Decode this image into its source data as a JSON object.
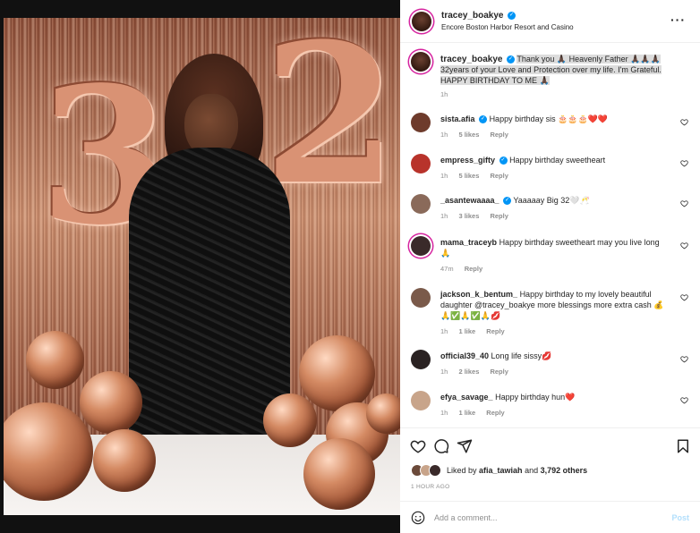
{
  "post": {
    "username": "tracey_boakye",
    "location": "Encore Boston Harbor Resort and Casino",
    "balloon_numbers": [
      "3",
      "2"
    ]
  },
  "caption": {
    "username": "tracey_boakye",
    "line1": "Thank you 🙏🏿 Heavenly Father 🙏🏿🙏🏿🙏🏿",
    "line2": "32years of your Love and Protection over my life. I'm Grateful.",
    "line3": "HAPPY BIRTHDAY TO ME 🙏🏿",
    "time": "1h"
  },
  "comments": [
    {
      "username": "sista.afia",
      "verified": true,
      "text": "Happy birthday sis 🎂🎂🎂❤️❤️",
      "time": "1h",
      "likes": "5 likes",
      "reply": "Reply",
      "avatar_color": "#6e3b2c"
    },
    {
      "username": "empress_gifty",
      "verified": true,
      "text": "Happy birthday sweetheart",
      "time": "1h",
      "likes": "5 likes",
      "reply": "Reply",
      "avatar_color": "#b8332b"
    },
    {
      "username": "_asantewaaaa_",
      "verified": true,
      "text": "Yaaaaay Big 32🤍🥂",
      "time": "1h",
      "likes": "3 likes",
      "reply": "Reply",
      "avatar_color": "#8a6a5a"
    },
    {
      "username": "mama_traceyb",
      "verified": false,
      "text": "Happy birthday sweetheart may you live long 🙏",
      "time": "47m",
      "likes": "",
      "reply": "Reply",
      "avatar_color": "#3a2a2a"
    },
    {
      "username": "jackson_k_bentum_",
      "verified": false,
      "text": "Happy birthday to my lovely beautiful daughter @tracey_boakye more blessings more extra cash 💰 🙏✅🙏✅🙏💋",
      "time": "1h",
      "likes": "1 like",
      "reply": "Reply",
      "avatar_color": "#7a5a4a"
    },
    {
      "username": "official39_40",
      "verified": false,
      "text": "Long life sissy💋",
      "time": "1h",
      "likes": "2 likes",
      "reply": "Reply",
      "avatar_color": "#2a2222"
    },
    {
      "username": "efya_savage_",
      "verified": false,
      "text": "Happy birthday hun❤️",
      "time": "1h",
      "likes": "1 like",
      "reply": "Reply",
      "avatar_color": "#c8a48a"
    }
  ],
  "likes": {
    "liked_by_prefix": "Liked by ",
    "liked_by_user": "afia_tawiah",
    "and": " and ",
    "others": "3,792 others"
  },
  "time_ago": "1 HOUR AGO",
  "add_comment": {
    "placeholder": "Add a comment...",
    "post_label": "Post"
  },
  "icons": {
    "header_menu": "more-horizontal-icon",
    "like": "heart-icon",
    "comment": "comment-icon",
    "share": "paper-plane-icon",
    "save": "bookmark-icon",
    "emoji": "emoji-icon",
    "verified": "verified-badge-icon"
  },
  "colors": {
    "verified_blue": "#0095f6",
    "story_ring": "#d6249f",
    "post_button_disabled": "#b2dffc",
    "muted_text": "#8e8e8e"
  }
}
